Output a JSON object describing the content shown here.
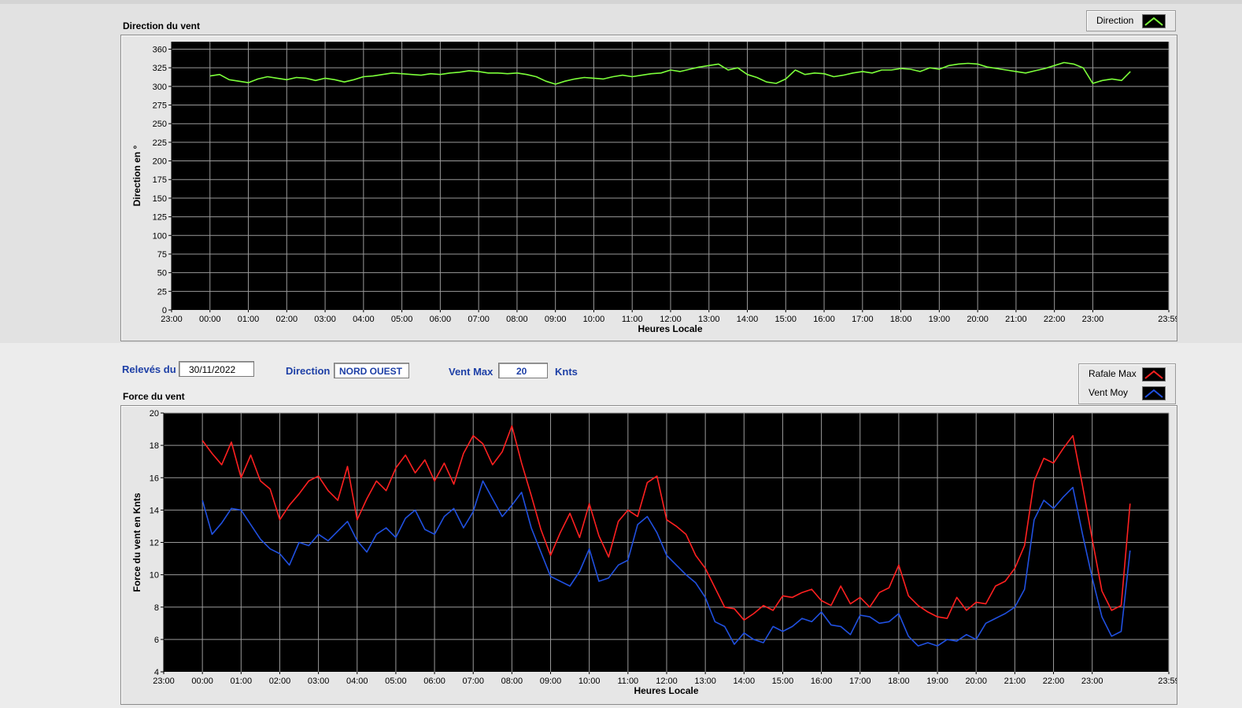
{
  "colors": {
    "direction": "#7cff3a",
    "rafale": "#ff2020",
    "moy": "#2050e0",
    "plot_bg": "#000000",
    "grid": "#9a9a9a",
    "label_blue": "#1d3fa6"
  },
  "direction_chart": {
    "title": "Direction du vent",
    "legend": [
      {
        "label": "Direction",
        "icon": "line-icon",
        "color": "#7cff3a"
      }
    ]
  },
  "controls": {
    "releves_label": "Relevés du",
    "releves_value": "30/11/2022",
    "direction_label": "Direction",
    "direction_value": "NORD OUEST",
    "ventmax_label": "Vent Max",
    "ventmax_value": "20",
    "ventmax_unit": "Knts"
  },
  "force_chart": {
    "title": "Force du vent",
    "legend": [
      {
        "label": "Rafale Max",
        "icon": "line-icon",
        "color": "#ff2020"
      },
      {
        "label": "Vent Moy",
        "icon": "line-icon",
        "color": "#2050e0"
      }
    ]
  },
  "chart_data": [
    {
      "type": "line",
      "title": "Direction du vent",
      "xlabel": "Heures Locale",
      "ylabel": "Direction en °",
      "ylim": [
        0,
        360
      ],
      "yticks": [
        "0",
        "25",
        "50",
        "75",
        "100",
        "125",
        "150",
        "175",
        "200",
        "225",
        "250",
        "275",
        "300",
        "325",
        "360"
      ],
      "yticks_values": [
        0,
        25,
        50,
        75,
        100,
        125,
        150,
        175,
        200,
        225,
        250,
        275,
        300,
        325,
        350
      ],
      "xticks": [
        "23:00",
        "00:00",
        "01:00",
        "02:00",
        "03:00",
        "04:00",
        "05:00",
        "06:00",
        "07:00",
        "08:00",
        "09:00",
        "10:00",
        "11:00",
        "12:00",
        "13:00",
        "14:00",
        "15:00",
        "16:00",
        "17:00",
        "18:00",
        "19:00",
        "20:00",
        "21:00",
        "22:00",
        "23:00",
        "23:59"
      ],
      "xlim_hours": [
        -1,
        24.98
      ],
      "grid": true,
      "series": [
        {
          "name": "Direction",
          "x": [
            0,
            0.25,
            0.5,
            0.75,
            1,
            1.25,
            1.5,
            1.75,
            2,
            2.25,
            2.5,
            2.75,
            3,
            3.25,
            3.5,
            3.75,
            4,
            4.25,
            4.5,
            4.75,
            5,
            5.25,
            5.5,
            5.75,
            6,
            6.25,
            6.5,
            6.75,
            7,
            7.25,
            7.5,
            7.75,
            8,
            8.25,
            8.5,
            8.75,
            9,
            9.25,
            9.5,
            9.75,
            10,
            10.25,
            10.5,
            10.75,
            11,
            11.25,
            11.5,
            11.75,
            12,
            12.25,
            12.5,
            12.75,
            13,
            13.25,
            13.5,
            13.75,
            14,
            14.25,
            14.5,
            14.75,
            15,
            15.25,
            15.5,
            15.75,
            16,
            16.25,
            16.5,
            16.75,
            17,
            17.25,
            17.5,
            17.75,
            18,
            18.25,
            18.5,
            18.75,
            19,
            19.25,
            19.5,
            19.75,
            20,
            20.25,
            20.5,
            20.75,
            21,
            21.25,
            21.5,
            21.75,
            22,
            22.25,
            22.5,
            22.75,
            23,
            23.25,
            23.5,
            23.75,
            23.98
          ],
          "values": [
            314,
            316,
            309,
            307,
            305,
            310,
            313,
            311,
            309,
            312,
            311,
            308,
            311,
            309,
            306,
            309,
            313,
            314,
            316,
            318,
            317,
            316,
            315,
            317,
            316,
            318,
            319,
            321,
            320,
            318,
            318,
            317,
            318,
            316,
            313,
            307,
            303,
            307,
            310,
            312,
            311,
            310,
            313,
            315,
            313,
            315,
            317,
            318,
            322,
            320,
            323,
            326,
            328,
            330,
            322,
            325,
            316,
            312,
            306,
            304,
            310,
            322,
            316,
            318,
            317,
            313,
            315,
            318,
            320,
            318,
            322,
            322,
            324,
            323,
            320,
            325,
            323,
            328,
            330,
            331,
            330,
            326,
            324,
            322,
            320,
            318,
            321,
            324,
            328,
            332,
            330,
            325,
            304,
            308,
            310,
            308,
            320
          ]
        }
      ]
    },
    {
      "type": "line",
      "title": "Force du vent",
      "xlabel": "Heures Locale",
      "ylabel": "Force du vent en Knts",
      "ylim": [
        4,
        20
      ],
      "yticks": [
        "4",
        "6",
        "8",
        "10",
        "12",
        "14",
        "16",
        "18",
        "20"
      ],
      "yticks_values": [
        4,
        6,
        8,
        10,
        12,
        14,
        16,
        18,
        20
      ],
      "xticks": [
        "23:00",
        "00:00",
        "01:00",
        "02:00",
        "03:00",
        "04:00",
        "05:00",
        "06:00",
        "07:00",
        "08:00",
        "09:00",
        "10:00",
        "11:00",
        "12:00",
        "13:00",
        "14:00",
        "15:00",
        "16:00",
        "17:00",
        "18:00",
        "19:00",
        "20:00",
        "21:00",
        "22:00",
        "23:00",
        "23:59"
      ],
      "xlim_hours": [
        -1,
        24.98
      ],
      "grid": true,
      "series": [
        {
          "name": "Rafale Max",
          "x": [
            0,
            0.25,
            0.5,
            0.75,
            1,
            1.25,
            1.5,
            1.75,
            2,
            2.25,
            2.5,
            2.75,
            3,
            3.25,
            3.5,
            3.75,
            4,
            4.25,
            4.5,
            4.75,
            5,
            5.25,
            5.5,
            5.75,
            6,
            6.25,
            6.5,
            6.75,
            7,
            7.25,
            7.5,
            7.75,
            8,
            8.25,
            8.5,
            8.75,
            9,
            9.25,
            9.5,
            9.75,
            10,
            10.25,
            10.5,
            10.75,
            11,
            11.25,
            11.5,
            11.75,
            12,
            12.25,
            12.5,
            12.75,
            13,
            13.25,
            13.5,
            13.75,
            14,
            14.25,
            14.5,
            14.75,
            15,
            15.25,
            15.5,
            15.75,
            16,
            16.25,
            16.5,
            16.75,
            17,
            17.25,
            17.5,
            17.75,
            18,
            18.25,
            18.5,
            18.75,
            19,
            19.25,
            19.5,
            19.75,
            20,
            20.25,
            20.5,
            20.75,
            21,
            21.25,
            21.5,
            21.75,
            22,
            22.25,
            22.5,
            22.75,
            23,
            23.25,
            23.5,
            23.75,
            23.98
          ],
          "values": [
            18.3,
            17.5,
            16.8,
            18.2,
            16.0,
            17.4,
            15.8,
            15.3,
            13.4,
            14.3,
            15.0,
            15.8,
            16.1,
            15.2,
            14.6,
            16.7,
            13.4,
            14.7,
            15.8,
            15.2,
            16.6,
            17.4,
            16.3,
            17.1,
            15.8,
            16.9,
            15.6,
            17.5,
            18.6,
            18.1,
            16.8,
            17.6,
            19.2,
            16.9,
            14.9,
            12.8,
            11.2,
            12.6,
            13.8,
            12.3,
            14.4,
            12.4,
            11.1,
            13.3,
            14.0,
            13.6,
            15.7,
            16.1,
            13.4,
            13.0,
            12.5,
            11.2,
            10.4,
            9.2,
            8.0,
            7.9,
            7.2,
            7.6,
            8.1,
            7.8,
            8.7,
            8.6,
            8.9,
            9.1,
            8.4,
            8.1,
            9.3,
            8.2,
            8.6,
            8.0,
            8.9,
            9.2,
            10.6,
            8.7,
            8.1,
            7.7,
            7.4,
            7.3,
            8.6,
            7.8,
            8.3,
            8.2,
            9.3,
            9.6,
            10.4,
            11.8,
            15.8,
            17.2,
            16.9,
            17.8,
            18.6,
            15.5,
            12.2,
            9.0,
            7.8,
            8.1,
            14.4
          ]
        },
        {
          "name": "Vent Moy",
          "x": [
            0,
            0.25,
            0.5,
            0.75,
            1,
            1.25,
            1.5,
            1.75,
            2,
            2.25,
            2.5,
            2.75,
            3,
            3.25,
            3.5,
            3.75,
            4,
            4.25,
            4.5,
            4.75,
            5,
            5.25,
            5.5,
            5.75,
            6,
            6.25,
            6.5,
            6.75,
            7,
            7.25,
            7.5,
            7.75,
            8,
            8.25,
            8.5,
            8.75,
            9,
            9.25,
            9.5,
            9.75,
            10,
            10.25,
            10.5,
            10.75,
            11,
            11.25,
            11.5,
            11.75,
            12,
            12.25,
            12.5,
            12.75,
            13,
            13.25,
            13.5,
            13.75,
            14,
            14.25,
            14.5,
            14.75,
            15,
            15.25,
            15.5,
            15.75,
            16,
            16.25,
            16.5,
            16.75,
            17,
            17.25,
            17.5,
            17.75,
            18,
            18.25,
            18.5,
            18.75,
            19,
            19.25,
            19.5,
            19.75,
            20,
            20.25,
            20.5,
            20.75,
            21,
            21.25,
            21.5,
            21.75,
            22,
            22.25,
            22.5,
            22.75,
            23,
            23.25,
            23.5,
            23.75,
            23.98
          ],
          "values": [
            14.6,
            12.5,
            13.2,
            14.1,
            14.0,
            13.1,
            12.2,
            11.6,
            11.3,
            10.6,
            12.0,
            11.8,
            12.5,
            12.1,
            12.7,
            13.3,
            12.1,
            11.4,
            12.5,
            12.9,
            12.3,
            13.5,
            14.0,
            12.8,
            12.5,
            13.6,
            14.1,
            12.9,
            13.9,
            15.8,
            14.7,
            13.6,
            14.3,
            15.1,
            12.9,
            11.4,
            9.9,
            9.6,
            9.3,
            10.2,
            11.6,
            9.6,
            9.8,
            10.6,
            10.9,
            13.1,
            13.6,
            12.6,
            11.2,
            10.6,
            10.0,
            9.5,
            8.6,
            7.1,
            6.8,
            5.7,
            6.4,
            6.0,
            5.8,
            6.8,
            6.5,
            6.8,
            7.3,
            7.1,
            7.7,
            6.9,
            6.8,
            6.3,
            7.5,
            7.4,
            7.0,
            7.1,
            7.6,
            6.2,
            5.6,
            5.8,
            5.6,
            6.0,
            5.9,
            6.3,
            6.0,
            7.0,
            7.3,
            7.6,
            8.0,
            9.1,
            13.4,
            14.6,
            14.1,
            14.8,
            15.4,
            12.5,
            9.8,
            7.4,
            6.2,
            6.5,
            11.5
          ]
        }
      ]
    }
  ]
}
